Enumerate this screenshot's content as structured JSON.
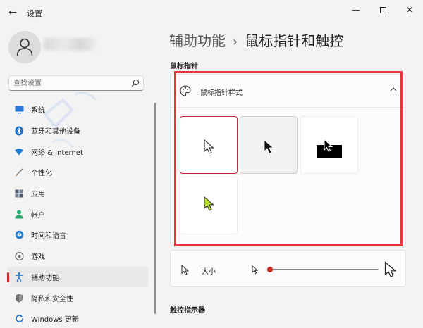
{
  "window": {
    "title": "设置",
    "back_glyph": "←",
    "minimize_glyph": "—",
    "close_glyph": "✕"
  },
  "search": {
    "placeholder": "查找设置"
  },
  "sidebar": {
    "items": [
      {
        "label": "系统",
        "icon": "monitor-icon",
        "color": "#2b79d6"
      },
      {
        "label": "蓝牙和其他设备",
        "icon": "bluetooth-icon",
        "color": "#1e70c9"
      },
      {
        "label": "网络 & Internet",
        "icon": "wifi-icon",
        "color": "#1f7ad1"
      },
      {
        "label": "个性化",
        "icon": "brush-icon",
        "color": "#d2691e"
      },
      {
        "label": "应用",
        "icon": "apps-icon",
        "color": "#4a5b6d"
      },
      {
        "label": "帐户",
        "icon": "person-icon",
        "color": "#2aa870"
      },
      {
        "label": "时间和语言",
        "icon": "globe-clock-icon",
        "color": "#1f7ad1"
      },
      {
        "label": "游戏",
        "icon": "gamepad-icon",
        "color": "#6b6b6b"
      },
      {
        "label": "辅助功能",
        "icon": "accessibility-icon",
        "color": "#1f6fc4",
        "active": true
      },
      {
        "label": "隐私和安全性",
        "icon": "shield-icon",
        "color": "#6b6b6b"
      },
      {
        "label": "Windows 更新",
        "icon": "update-icon",
        "color": "#1f7ad1"
      }
    ]
  },
  "header": {
    "parent": "辅助功能",
    "separator": "›",
    "current": "鼠标指针和触控"
  },
  "section_pointer": {
    "title": "鼠标指针",
    "style_card": {
      "label": "鼠标指针样式",
      "expanded": true,
      "options": [
        {
          "name": "white",
          "selected": true
        },
        {
          "name": "black",
          "selected": false
        },
        {
          "name": "inverted",
          "selected": false
        },
        {
          "name": "custom",
          "selected": false,
          "color": "#b5e51a"
        }
      ]
    },
    "size": {
      "label": "大小",
      "value": 1,
      "min": 1,
      "max": 15
    }
  },
  "section_touch": {
    "title": "触控指示器"
  },
  "colors": {
    "accent": "#c42b1c",
    "highlight_box": "#e8343e"
  }
}
